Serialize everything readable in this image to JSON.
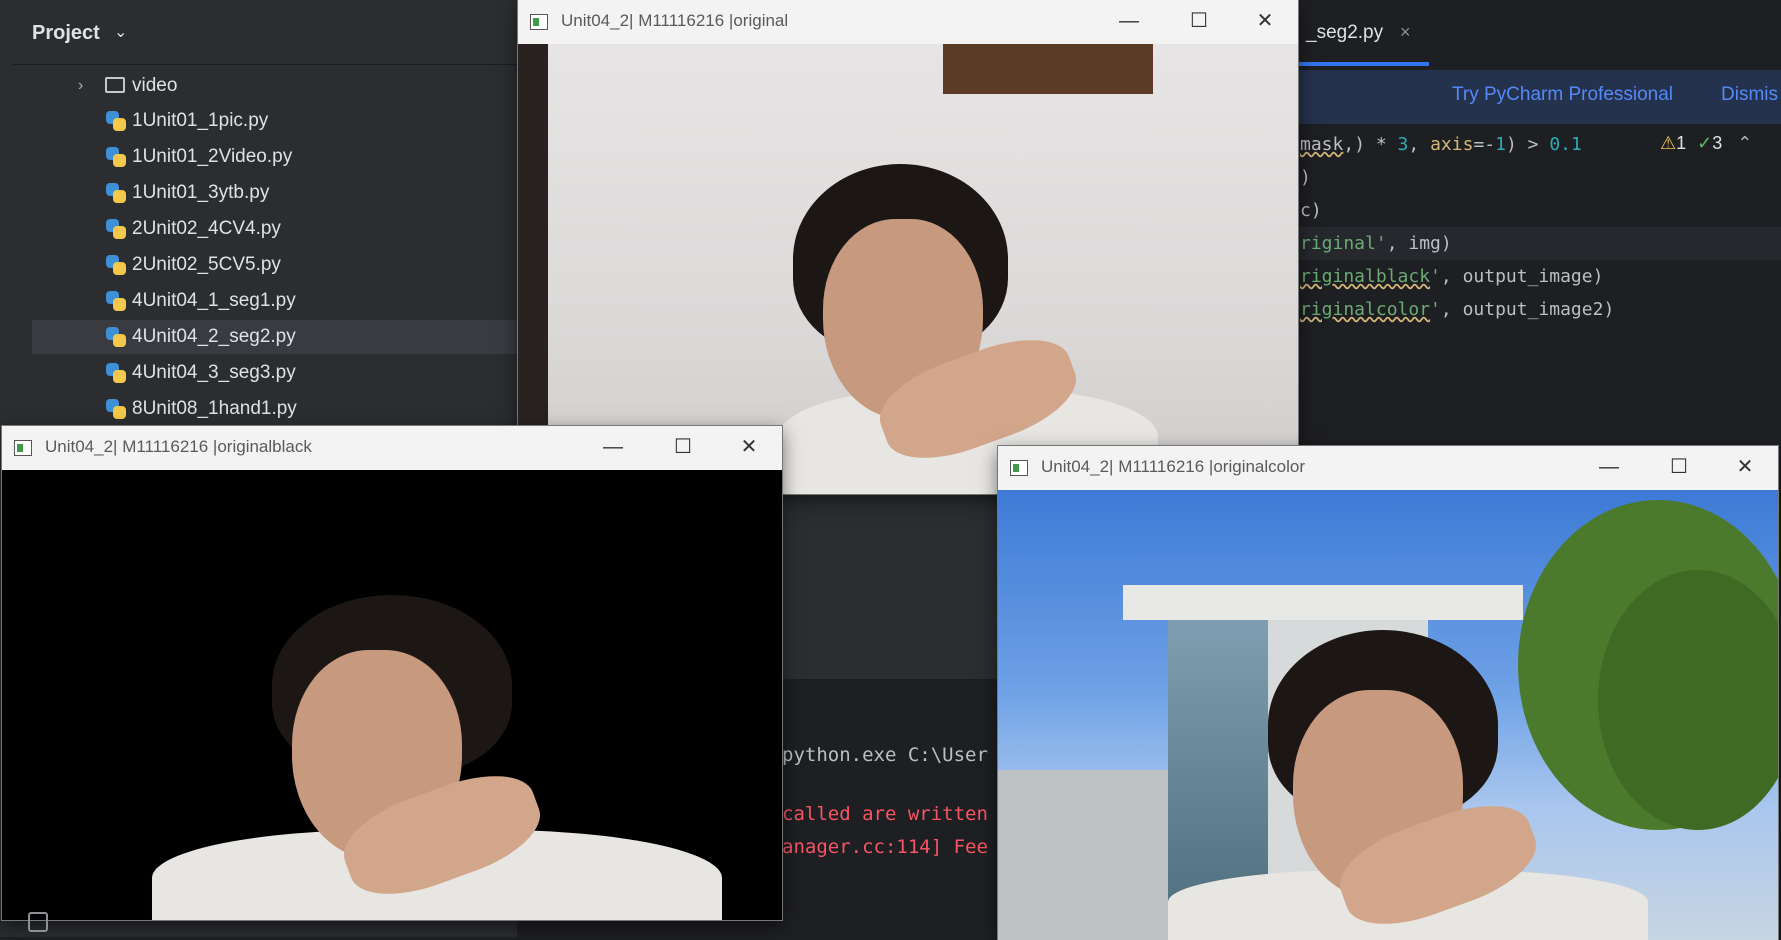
{
  "project": {
    "title": "Project",
    "items": [
      {
        "label": "video",
        "type": "folder"
      },
      {
        "label": "1Unit01_1pic.py",
        "type": "py"
      },
      {
        "label": "1Unit01_2Video.py",
        "type": "py"
      },
      {
        "label": "1Unit01_3ytb.py",
        "type": "py"
      },
      {
        "label": "2Unit02_4CV4.py",
        "type": "py"
      },
      {
        "label": "2Unit02_5CV5.py",
        "type": "py"
      },
      {
        "label": "4Unit04_1_seg1.py",
        "type": "py"
      },
      {
        "label": "4Unit04_2_seg2.py",
        "type": "py",
        "selected": true
      },
      {
        "label": "4Unit04_3_seg3.py",
        "type": "py"
      },
      {
        "label": "8Unit08_1hand1.py",
        "type": "py"
      }
    ]
  },
  "editor": {
    "tab_label": "_seg2.py",
    "tab_close": "×",
    "promo_link": "Try PyCharm Professional",
    "promo_dismiss": "Dismis",
    "inspections": {
      "warnings": "1",
      "checks": "3"
    },
    "code_lines": [
      "mask,) * 3, axis=-1) > 0.1",
      ")",
      "c)",
      "riginal', img)",
      "riginalblack', output_image)",
      "riginalcolor', output_image2)"
    ]
  },
  "terminal": {
    "lines": [
      "python.exe C:\\User",
      "called are written",
      "anager.cc:114] Fee"
    ]
  },
  "windows": {
    "original": {
      "title": "Unit04_2| M11116216 |original"
    },
    "originalblack": {
      "title": "Unit04_2| M11116216 |originalblack"
    },
    "originalcolor": {
      "title": "Unit04_2| M11116216 |originalcolor"
    }
  },
  "window_controls": {
    "minimize": "—",
    "maximize": "☐",
    "close": "✕"
  },
  "colors": {
    "ide_bg": "#1e1f22",
    "panel_bg": "#2b2d30",
    "accent": "#3574f0",
    "link": "#548af7"
  }
}
